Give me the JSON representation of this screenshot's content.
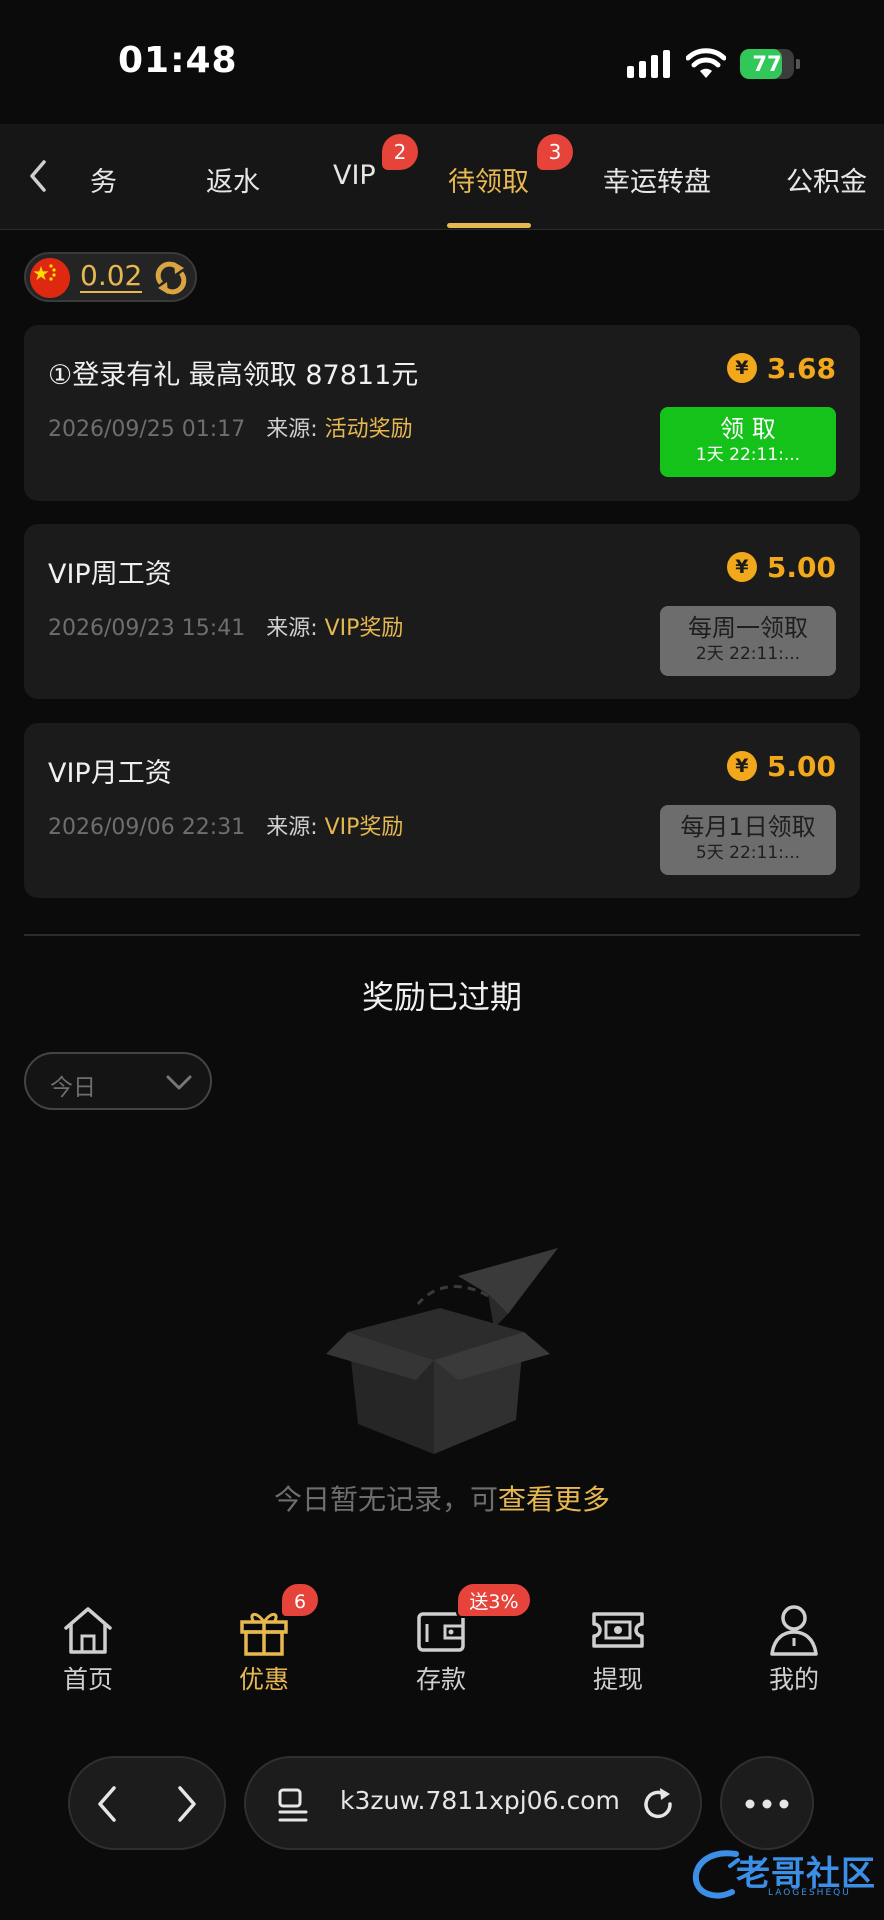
{
  "status_bar": {
    "time": "01:48",
    "battery": "77",
    "battery_level": 0.77
  },
  "tabs": [
    {
      "label": "务",
      "badge": ""
    },
    {
      "label": "返水",
      "badge": ""
    },
    {
      "label": "VIP",
      "badge": "2"
    },
    {
      "label": "待领取",
      "badge": "3",
      "active": true
    },
    {
      "label": "幸运转盘",
      "badge": ""
    },
    {
      "label": "公积金",
      "badge": ""
    }
  ],
  "balance": {
    "amount": "0.02"
  },
  "rewards": [
    {
      "title": "①登录有礼 最高领取 87811元",
      "date": "2026/09/25 01:17",
      "source_label": "来源:",
      "source": "活动奖励",
      "amount": "3.68",
      "button_label": "领 取",
      "button_sub": "1天 22:11:...",
      "state": "ready"
    },
    {
      "title": "VIP周工资",
      "date": "2026/09/23 15:41",
      "source_label": "来源:",
      "source": "VIP奖励",
      "amount": "5.00",
      "button_label": "每周一领取",
      "button_sub": "2天 22:11:...",
      "state": "wait"
    },
    {
      "title": "VIP月工资",
      "date": "2026/09/06 22:31",
      "source_label": "来源:",
      "source": "VIP奖励",
      "amount": "5.00",
      "button_label": "每月1日领取",
      "button_sub": "5天 22:11:...",
      "state": "wait"
    }
  ],
  "expired": {
    "title": "奖励已过期",
    "filter_value": "今日",
    "empty_text": "今日暂无记录，可",
    "empty_link": "查看更多"
  },
  "bottom_nav": [
    {
      "label": "首页",
      "icon": "home-icon",
      "badge": ""
    },
    {
      "label": "优惠",
      "icon": "gift-icon",
      "badge": "6",
      "active": true
    },
    {
      "label": "存款",
      "icon": "wallet-icon",
      "badge": "送3%"
    },
    {
      "label": "提现",
      "icon": "withdraw-ticket-icon",
      "badge": ""
    },
    {
      "label": "我的",
      "icon": "user-icon",
      "badge": ""
    }
  ],
  "browser": {
    "url": "k3zuw.7811xpj06.com"
  },
  "watermark": {
    "text": "老哥社区",
    "sub": "LAOGESHEQU"
  },
  "colors": {
    "accent": "#e6b84f",
    "amount": "#f2a81b",
    "claim_ready": "#14c21a",
    "badge": "#e6443a"
  }
}
